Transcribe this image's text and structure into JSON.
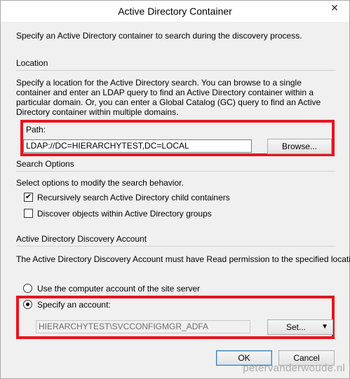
{
  "window": {
    "title": "Active Directory Container",
    "close_glyph": "✕"
  },
  "intro": "Specify an Active Directory container to search during the discovery process.",
  "location": {
    "heading": "Location",
    "description": "Specify a location for the Active Directory search. You can browse to a single container and enter an LDAP query to find an Active Directory container within a particular domain. Or, you can enter a Global Catalog (GC) query to find an Active Directory container within multiple domains.",
    "path_label": "Path:",
    "path_value": "LDAP://DC=HIERARCHYTEST,DC=LOCAL",
    "browse_label": "Browse..."
  },
  "search_options": {
    "heading": "Search Options",
    "description": "Select options to modify the search behavior.",
    "recursive_label": "Recursively search Active Directory child containers",
    "recursive_checked": true,
    "groups_label": "Discover objects within Active Directory groups",
    "groups_checked": false
  },
  "account": {
    "heading": "Active Directory Discovery Account",
    "description": "The Active Directory Discovery Account must have Read permission to the specified location.",
    "computer_label": "Use the computer account of the site server",
    "specify_label": "Specify an account:",
    "selected": "specify",
    "account_value": "HIERARCHYTEST\\SVCCONFIGMGR_ADFA",
    "set_label": "Set...",
    "set_arrow": "▼"
  },
  "footer": {
    "ok_label": "OK",
    "cancel_label": "Cancel"
  },
  "watermark": "petervanderwoude.nl",
  "colors": {
    "highlight": "#e8141e"
  }
}
